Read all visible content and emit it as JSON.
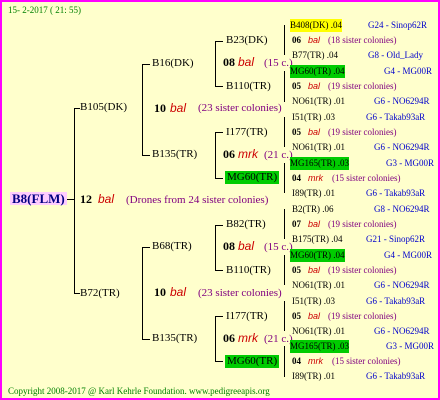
{
  "header": "15-  2-2017 ( 21: 55)",
  "footer": "Copyright 2008-2017 @ Karl Kehrle Foundation.   www.pedigreeapis.org",
  "root": {
    "name": "B8(FLM)",
    "gen": "12",
    "sym": "bal",
    "note": "(Drones from 24 sister colonies)"
  },
  "l1": [
    {
      "name": "B105(DK)",
      "gen": "10",
      "sym": "bal",
      "note": "(23 sister colonies)"
    },
    {
      "name": "B72(TR)",
      "gen": "10",
      "sym": "bal",
      "note": "(23 sister colonies)"
    }
  ],
  "l2": [
    {
      "name": "B16(DK)",
      "gen": "08",
      "sym": "bal",
      "note": "(15 c.)"
    },
    {
      "name": "B135(TR)",
      "gen": "06",
      "sym": "mrk",
      "note": "(21 c.)"
    },
    {
      "name": "B68(TR)",
      "gen": "08",
      "sym": "bal",
      "note": "(15 c.)"
    },
    {
      "name": "B135(TR)",
      "gen": "06",
      "sym": "mrk",
      "note": "(21 c.)"
    }
  ],
  "l3": [
    "B23(DK)",
    "B110(TR)",
    "I177(TR)",
    "MG60(TR)",
    "B82(TR)",
    "B110(TR)",
    "I177(TR)",
    "MG60(TR)"
  ],
  "l4": [
    {
      "name": "B408(DK) .04",
      "src": "G24 - Sinop62R",
      "gen": "06",
      "sym": "bal",
      "note": "(18 sister colonies)"
    },
    {
      "name": "B77(TR) .04",
      "src": "G8 - Old_Lady"
    },
    {
      "name": "MG60(TR) .04",
      "src": "G4 - MG00R",
      "gen": "05",
      "sym": "bal",
      "note": "(19 sister colonies)"
    },
    {
      "name": "NO61(TR) .01",
      "src": "G6 - NO6294R"
    },
    {
      "name": "I51(TR) .03",
      "src": "G6 - Takab93aR",
      "gen": "05",
      "sym": "bal",
      "note": "(19 sister colonies)"
    },
    {
      "name": "NO61(TR) .01",
      "src": "G6 - NO6294R"
    },
    {
      "name": "MG165(TR) .03",
      "src": "G3 - MG00R",
      "gen": "04",
      "sym": "mrk",
      "note": "(15 sister colonies)"
    },
    {
      "name": "I89(TR) .01",
      "src": "G6 - Takab93aR"
    },
    {
      "name": "B2(TR) .06",
      "src": "G8 - NO6294R",
      "gen": "07",
      "sym": "bal",
      "note": "(19 sister colonies)"
    },
    {
      "name": "B175(TR) .04",
      "src": "G21 - Sinop62R"
    },
    {
      "name": "MG60(TR) .04",
      "src": "G4 - MG00R",
      "gen": "05",
      "sym": "bal",
      "note": "(19 sister colonies)"
    },
    {
      "name": "NO61(TR) .01",
      "src": "G6 - NO6294R"
    },
    {
      "name": "I51(TR) .03",
      "src": "G6 - Takab93aR",
      "gen": "05",
      "sym": "bal",
      "note": "(19 sister colonies)"
    },
    {
      "name": "NO61(TR) .01",
      "src": "G6 - NO6294R"
    },
    {
      "name": "MG165(TR) .03",
      "src": "G3 - MG00R",
      "gen": "04",
      "sym": "mrk",
      "note": "(15 sister colonies)"
    },
    {
      "name": "I89(TR) .01",
      "src": "G6 - Takab93aR"
    }
  ]
}
